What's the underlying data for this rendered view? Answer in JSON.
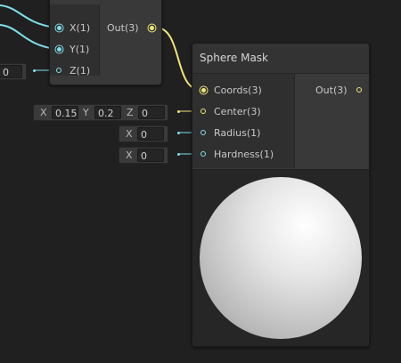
{
  "left_node": {
    "inputs": [
      {
        "label": "X(1)"
      },
      {
        "label": "Y(1)"
      },
      {
        "label": "Z(1)"
      }
    ],
    "output": {
      "label": "Out(3)"
    },
    "z_field_value": "0"
  },
  "sphere_mask": {
    "title": "Sphere Mask",
    "inputs": [
      {
        "label": "Coords(3)"
      },
      {
        "label": "Center(3)"
      },
      {
        "label": "Radius(1)"
      },
      {
        "label": "Hardness(1)"
      }
    ],
    "output": {
      "label": "Out(3)"
    },
    "center_field": {
      "x_label": "X",
      "x_value": "0.15",
      "y_label": "Y",
      "y_value": "0.2",
      "z_label": "Z",
      "z_value": "0"
    },
    "radius_field": {
      "x_label": "X",
      "x_value": "0"
    },
    "hardness_field": {
      "x_label": "X",
      "x_value": "0"
    }
  },
  "colors": {
    "vector1": "#7fe0e8",
    "vector3": "#f0e87a",
    "canvas": "#202020"
  }
}
